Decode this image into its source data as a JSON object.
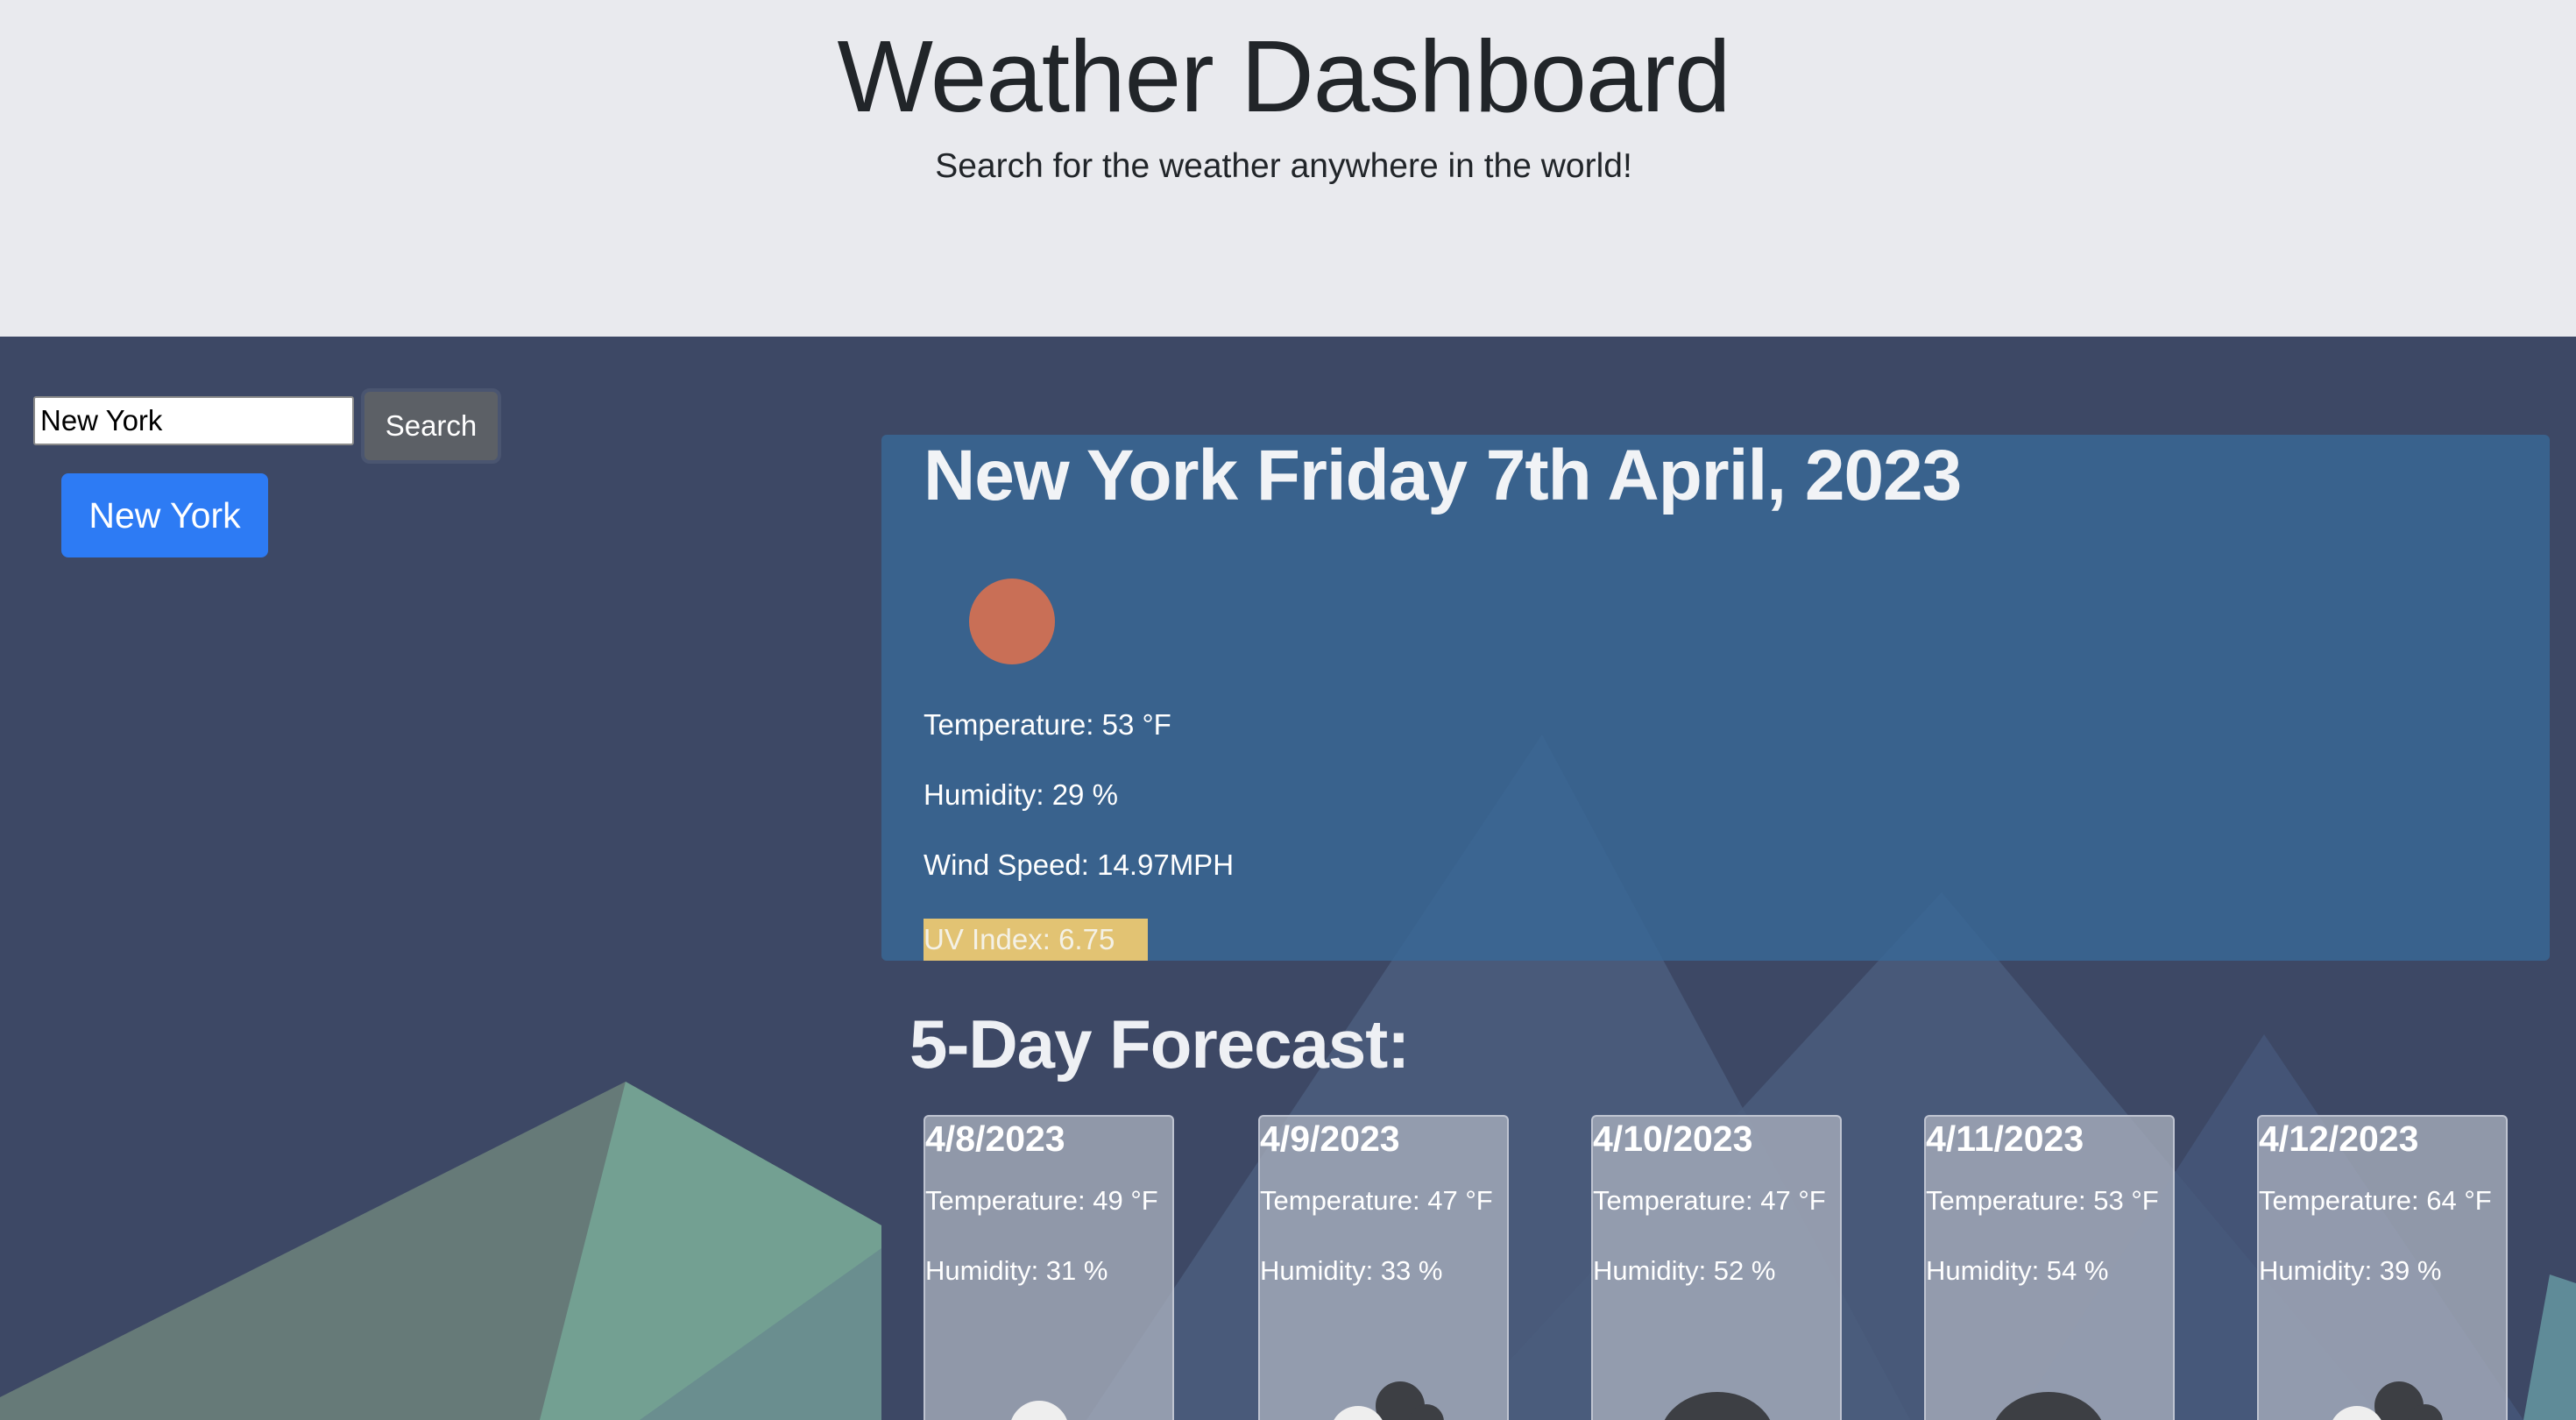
{
  "header": {
    "title": "Weather Dashboard",
    "subtitle": "Search for the weather anywhere in the world!"
  },
  "search": {
    "value": "New York",
    "button_label": "Search"
  },
  "history": {
    "items": [
      {
        "label": "New York"
      }
    ]
  },
  "current": {
    "title": "New York Friday 7th April, 2023",
    "icon": "sun-icon",
    "icon_color": "#c96f56",
    "temperature": "Temperature: 53 °F",
    "humidity": "Humidity: 29 %",
    "wind": "Wind Speed: 14.97MPH",
    "uv": "UV Index: 6.75",
    "uv_color": "#e2c373"
  },
  "forecast": {
    "title": "5-Day Forecast:",
    "days": [
      {
        "date": "4/8/2023",
        "temperature": "Temperature: 49 °F",
        "humidity": "Humidity: 31 %",
        "icon": "clear-sky-icon"
      },
      {
        "date": "4/9/2023",
        "temperature": "Temperature: 47 °F",
        "humidity": "Humidity: 33 %",
        "icon": "few-clouds-icon"
      },
      {
        "date": "4/10/2023",
        "temperature": "Temperature: 47 °F",
        "humidity": "Humidity: 52 %",
        "icon": "overcast-clouds-icon"
      },
      {
        "date": "4/11/2023",
        "temperature": "Temperature: 53 °F",
        "humidity": "Humidity: 54 %",
        "icon": "overcast-clouds-icon"
      },
      {
        "date": "4/12/2023",
        "temperature": "Temperature: 64 °F",
        "humidity": "Humidity: 39 %",
        "icon": "few-clouds-icon"
      }
    ]
  },
  "colors": {
    "page_background": "#3d4865",
    "header_background": "#e9eaee",
    "primary_button": "#2d7bf4",
    "secondary_button": "#5c6066"
  }
}
